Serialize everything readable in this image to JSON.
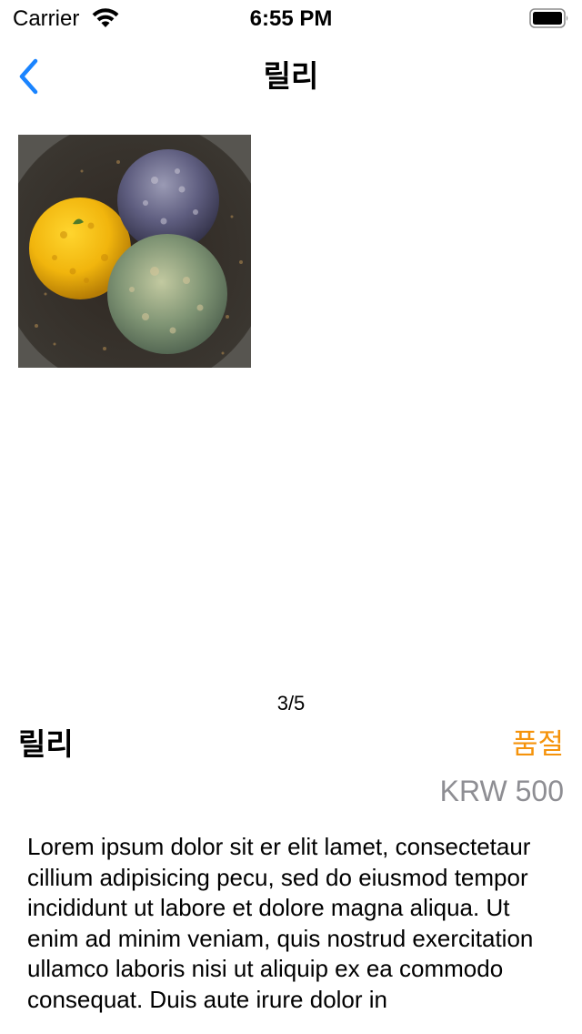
{
  "status_bar": {
    "carrier": "Carrier",
    "time": "6:55 PM",
    "wifi_icon": "wifi-icon",
    "battery_icon": "battery-full-icon"
  },
  "nav": {
    "back_icon": "chevron-left-icon",
    "title": "릴리"
  },
  "carousel": {
    "page_indicator": "3/5"
  },
  "product": {
    "name": "릴리",
    "stock_status": "품절",
    "price": "KRW 500",
    "description": "Lorem ipsum dolor sit er elit lamet, consectetaur cillium adipisicing pecu, sed do eiusmod tempor incididunt ut labore et dolore magna aliqua. Ut enim ad minim veniam, quis nostrud exercitation ullamco laboris nisi ut aliquip ex ea commodo consequat. Duis aute irure dolor in"
  },
  "colors": {
    "accent": "#1a84ff",
    "stock_status": "#f5930b",
    "price": "#8e8e93"
  }
}
